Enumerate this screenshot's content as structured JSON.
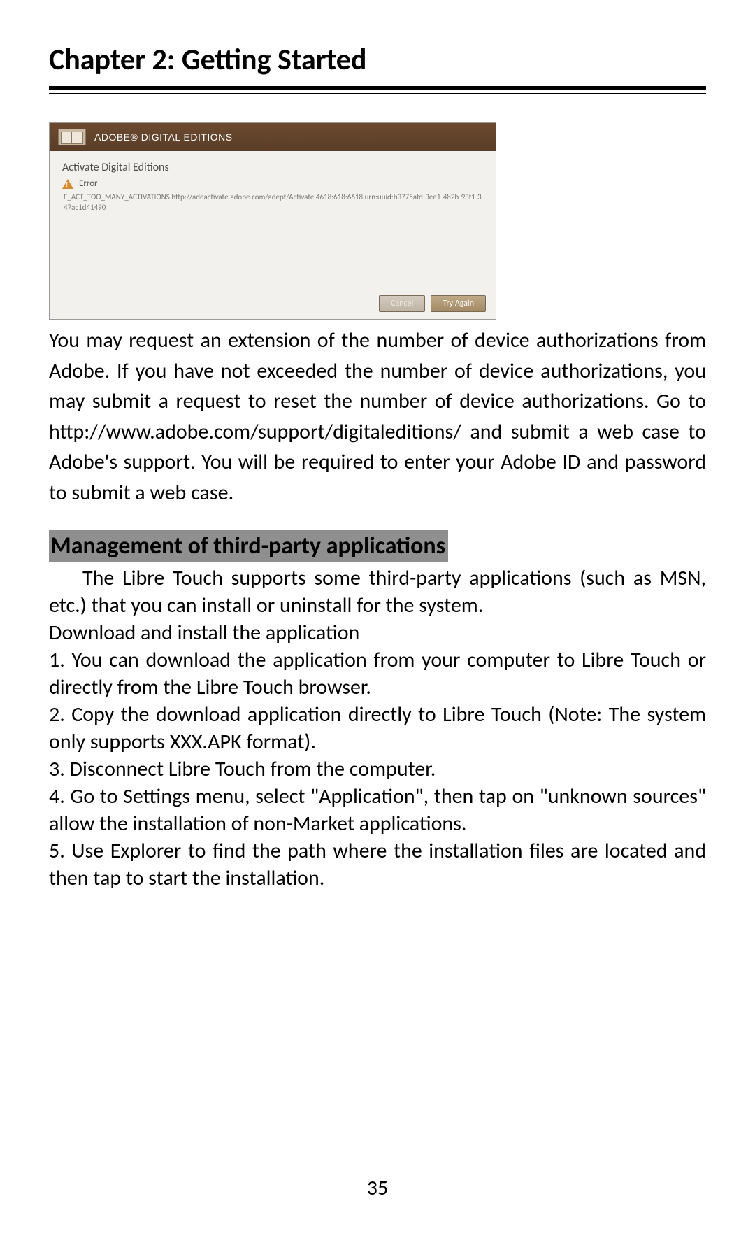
{
  "chapter_title": "Chapter 2: Getting Started",
  "screenshot": {
    "app_title": "ADOBE® DIGITAL EDITIONS",
    "dialog_title": "Activate Digital Editions",
    "error_label": "Error",
    "error_text": "E_ACT_TOO_MANY_ACTIVATIONS http://adeactivate.adobe.com/adept/Activate 4618:618:6618 urn:uuid:b3775afd-3ee1-482b-93f1-347ac1d41490",
    "cancel_label": "Cancel",
    "tryagain_label": "Try Again"
  },
  "paragraph_after_screenshot": "You may request an extension of the number of device authorizations from Adobe.  If you have not exceeded the number of device authorizations, you may submit a request to reset the number of device authorizations. Go to http://www.adobe.com/support/digitaleditions/ and submit a web case to Adobe's support. You will be required to enter your Adobe ID and password to submit a web case.",
  "section_heading": "Management of third-party applications",
  "section_intro": "The Libre Touch supports some third-party applications (such as MSN, etc.) that you can install or uninstall for the system.",
  "download_heading": "Download and install the application",
  "steps": {
    "1": "1.   You can download the application from your computer to Libre Touch or directly from the Libre Touch browser.",
    "2": "2.   Copy the download application directly to Libre Touch (Note: The system only supports XXX.APK format).",
    "3": "3.   Disconnect Libre Touch from the computer.",
    "4": "4.  Go to Settings menu, select \"Application\", then tap on \"unknown sources\" allow the installation of non-Market applications.",
    "5": "5.   Use Explorer to find the path where the installation files are located and then tap to start the installation."
  },
  "page_number": "35"
}
